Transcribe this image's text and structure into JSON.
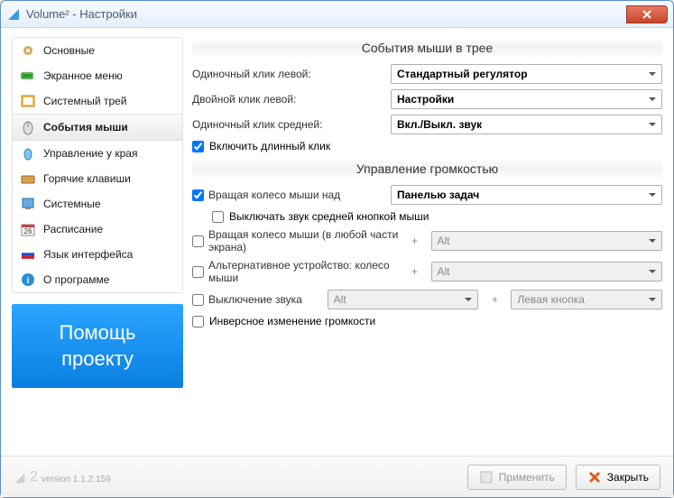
{
  "window": {
    "title": "Volume² - Настройки"
  },
  "sidebar": {
    "items": [
      {
        "label": "Основные"
      },
      {
        "label": "Экранное меню"
      },
      {
        "label": "Системный трей"
      },
      {
        "label": "События мыши"
      },
      {
        "label": "Управление у края"
      },
      {
        "label": "Горячие клавиши"
      },
      {
        "label": "Системные"
      },
      {
        "label": "Расписание"
      },
      {
        "label": "Язык интерфейса"
      },
      {
        "label": "О программе"
      }
    ]
  },
  "promo": {
    "line1": "Помощь",
    "line2": "проекту"
  },
  "sections": {
    "tray": {
      "title": "События мыши в трее",
      "rows": [
        {
          "label": "Одиночный клик левой:",
          "value": "Стандартный регулятор"
        },
        {
          "label": "Двойной клик левой:",
          "value": "Настройки"
        },
        {
          "label": "Одиночный клик средней:",
          "value": "Вкл./Выкл. звук"
        }
      ],
      "longclick": "Включить длинный клик"
    },
    "volume": {
      "title": "Управление громкостью",
      "wheel_over": {
        "label": "Вращая колесо мыши над",
        "value": "Панелью задач"
      },
      "mute_middle": "Выключать звук средней кнопкой мыши",
      "wheel_anywhere": {
        "label": "Вращая колесо мыши (в любой части экрана)",
        "mod": "Alt"
      },
      "alt_device": {
        "label": "Альтернативное устройство: колесо мыши",
        "mod": "Alt"
      },
      "mute": {
        "label": "Выключение звука",
        "mod": "Alt",
        "btn": "Левая кнопка"
      },
      "inverse": "Инверсное изменение громкости"
    }
  },
  "footer": {
    "version": "version 1.1.2.159",
    "apply": "Применить",
    "close": "Закрыть"
  }
}
